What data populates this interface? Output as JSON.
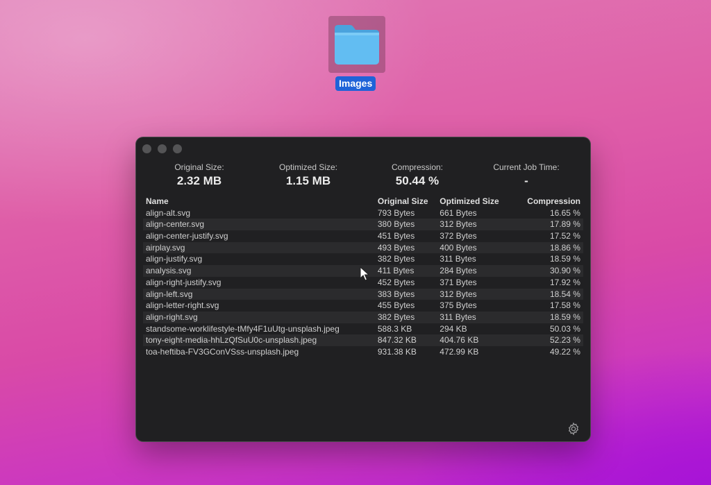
{
  "desktop": {
    "folder_label": "Images",
    "folder_color": "#5fb9f0"
  },
  "stats": {
    "original_label": "Original Size:",
    "original_value": "2.32 MB",
    "optimized_label": "Optimized Size:",
    "optimized_value": "1.15 MB",
    "compression_label": "Compression:",
    "compression_value": "50.44 %",
    "job_time_label": "Current Job Time:",
    "job_time_value": "-"
  },
  "table": {
    "headers": [
      "Name",
      "Original Size",
      "Optimized Size",
      "Compression"
    ],
    "rows": [
      [
        "align-alt.svg",
        "793 Bytes",
        "661 Bytes",
        "16.65 %"
      ],
      [
        "align-center.svg",
        "380 Bytes",
        "312 Bytes",
        "17.89 %"
      ],
      [
        "align-center-justify.svg",
        "451 Bytes",
        "372 Bytes",
        "17.52 %"
      ],
      [
        "airplay.svg",
        "493 Bytes",
        "400 Bytes",
        "18.86 %"
      ],
      [
        "align-justify.svg",
        "382 Bytes",
        "311 Bytes",
        "18.59 %"
      ],
      [
        "analysis.svg",
        "411 Bytes",
        "284 Bytes",
        "30.90 %"
      ],
      [
        "align-right-justify.svg",
        "452 Bytes",
        "371 Bytes",
        "17.92 %"
      ],
      [
        "align-left.svg",
        "383 Bytes",
        "312 Bytes",
        "18.54 %"
      ],
      [
        "align-letter-right.svg",
        "455 Bytes",
        "375 Bytes",
        "17.58 %"
      ],
      [
        "align-right.svg",
        "382 Bytes",
        "311 Bytes",
        "18.59 %"
      ],
      [
        "standsome-worklifestyle-tMfy4F1uUtg-unsplash.jpeg",
        "588.3 KB",
        "294 KB",
        "50.03 %"
      ],
      [
        "tony-eight-media-hhLzQfSuU0c-unsplash.jpeg",
        "847.32 KB",
        "404.76 KB",
        "52.23 %"
      ],
      [
        "toa-heftiba-FV3GConVSss-unsplash.jpeg",
        "931.38 KB",
        "472.99 KB",
        "49.22 %"
      ]
    ]
  },
  "icons": {
    "folder": "folder-icon",
    "settings": "gear-icon",
    "pointer": "cursor-icon"
  }
}
